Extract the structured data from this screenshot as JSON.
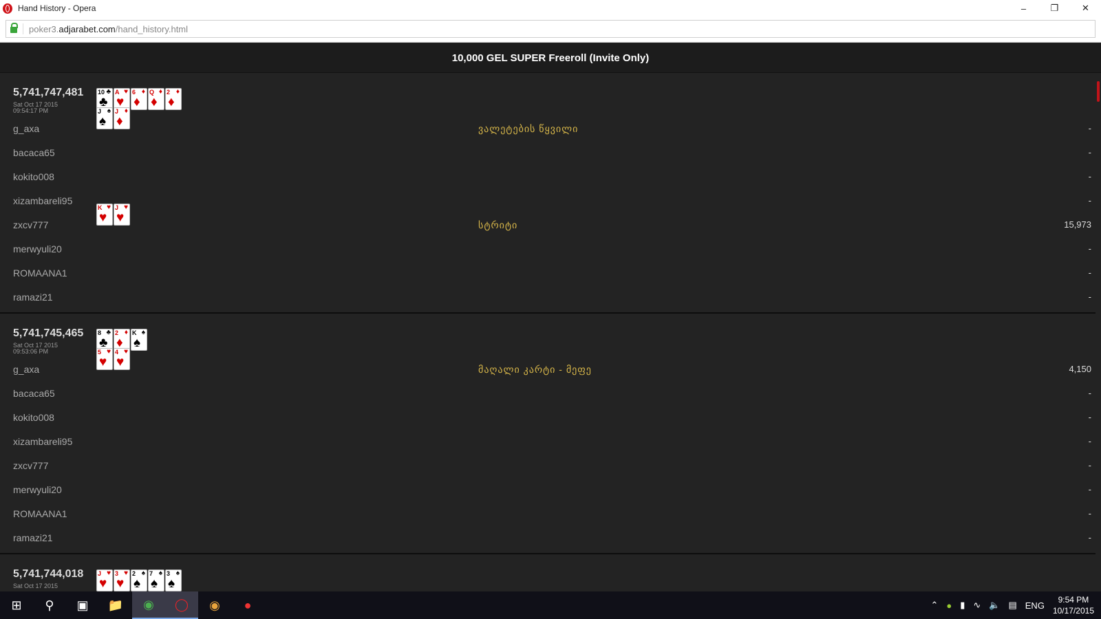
{
  "window": {
    "title": "Hand History - Opera",
    "url_scheme": "poker3.",
    "url_host": "adjarabet.com",
    "url_path": "/hand_history.html"
  },
  "header": {
    "title": "10,000 GEL SUPER Freeroll (Invite Only)"
  },
  "hands": [
    {
      "id": "5,741,747,481",
      "date": "Sat Oct 17 2015",
      "time": "09:54:17 PM",
      "board": [
        {
          "r": "10",
          "s": "♣"
        },
        {
          "r": "A",
          "s": "♥"
        },
        {
          "r": "6",
          "s": "♦"
        },
        {
          "r": "Q",
          "s": "♦"
        },
        {
          "r": "2",
          "s": "♦"
        }
      ],
      "players": [
        {
          "name": "g_axa",
          "cards": [
            {
              "r": "J",
              "s": "♠"
            },
            {
              "r": "J",
              "s": "♦"
            }
          ],
          "result": "ვალეტების წყვილი",
          "win": "-"
        },
        {
          "name": "bacaca65",
          "cards": [],
          "result": "",
          "win": "-"
        },
        {
          "name": "kokito008",
          "cards": [],
          "result": "",
          "win": "-"
        },
        {
          "name": "xizambareli95",
          "cards": [],
          "result": "",
          "win": "-"
        },
        {
          "name": "zxcv777",
          "cards": [
            {
              "r": "K",
              "s": "♥"
            },
            {
              "r": "J",
              "s": "♥"
            }
          ],
          "result": "სტრიტი",
          "win": "15,973"
        },
        {
          "name": "merwyuli20",
          "cards": [],
          "result": "",
          "win": "-"
        },
        {
          "name": "ROMAANA1",
          "cards": [],
          "result": "",
          "win": "-"
        },
        {
          "name": "ramazi21",
          "cards": [],
          "result": "",
          "win": "-"
        }
      ]
    },
    {
      "id": "5,741,745,465",
      "date": "Sat Oct 17 2015",
      "time": "09:53:06 PM",
      "board": [
        {
          "r": "8",
          "s": "♣"
        },
        {
          "r": "2",
          "s": "♦"
        },
        {
          "r": "K",
          "s": "♠"
        }
      ],
      "players": [
        {
          "name": "g_axa",
          "cards": [
            {
              "r": "5",
              "s": "♥"
            },
            {
              "r": "4",
              "s": "♥"
            }
          ],
          "result": "მაღალი კარტი - მეფე",
          "win": "4,150"
        },
        {
          "name": "bacaca65",
          "cards": [],
          "result": "",
          "win": "-"
        },
        {
          "name": "kokito008",
          "cards": [],
          "result": "",
          "win": "-"
        },
        {
          "name": "xizambareli95",
          "cards": [],
          "result": "",
          "win": "-"
        },
        {
          "name": "zxcv777",
          "cards": [],
          "result": "",
          "win": "-"
        },
        {
          "name": "merwyuli20",
          "cards": [],
          "result": "",
          "win": "-"
        },
        {
          "name": "ROMAANA1",
          "cards": [],
          "result": "",
          "win": "-"
        },
        {
          "name": "ramazi21",
          "cards": [],
          "result": "",
          "win": "-"
        }
      ]
    },
    {
      "id": "5,741,744,018",
      "date": "Sat Oct 17 2015",
      "time": "",
      "board": [
        {
          "r": "J",
          "s": "♥"
        },
        {
          "r": "3",
          "s": "♥"
        },
        {
          "r": "2",
          "s": "♠"
        },
        {
          "r": "7",
          "s": "♠"
        },
        {
          "r": "3",
          "s": "♠"
        }
      ],
      "players": []
    }
  ],
  "taskbar": {
    "lang": "ENG",
    "time": "9:54 PM",
    "date": "10/17/2015"
  }
}
